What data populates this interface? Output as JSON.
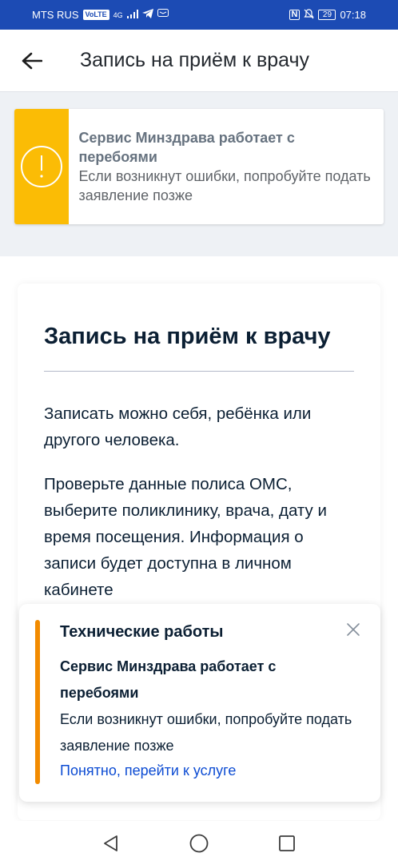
{
  "status_bar": {
    "carrier": "MTS RUS",
    "volte": "VoLTE",
    "network": "4G",
    "nfc": "N",
    "battery": "29",
    "time": "07:18"
  },
  "app_bar": {
    "title": "Запись на приём к врачу"
  },
  "warning_banner": {
    "title": "Сервис Минздрава работает с перебоями",
    "text": "Если возникнут ошибки, попробуйте подать заявление позже",
    "color": "#fbbc05"
  },
  "main": {
    "heading": "Запись на приём к врачу",
    "paragraph1": "Записать можно себя, ребёнка или другого человека.",
    "paragraph2": "Проверьте данные полиса ОМС, выберите поликлинику, врача, дату и время посещения. Информация о записи будет доступна в личном кабинете"
  },
  "tech_notice": {
    "title": "Технические работы",
    "subtitle": "Сервис Минздрава работает с перебоями",
    "text": "Если возникнут ошибки, попробуйте подать заявление позже",
    "link": "Понятно, перейти к услуге",
    "accent_color": "#f28b00"
  },
  "nav": {
    "back": "back-triangle-icon",
    "home": "home-circle-icon",
    "recents": "recents-square-icon"
  }
}
